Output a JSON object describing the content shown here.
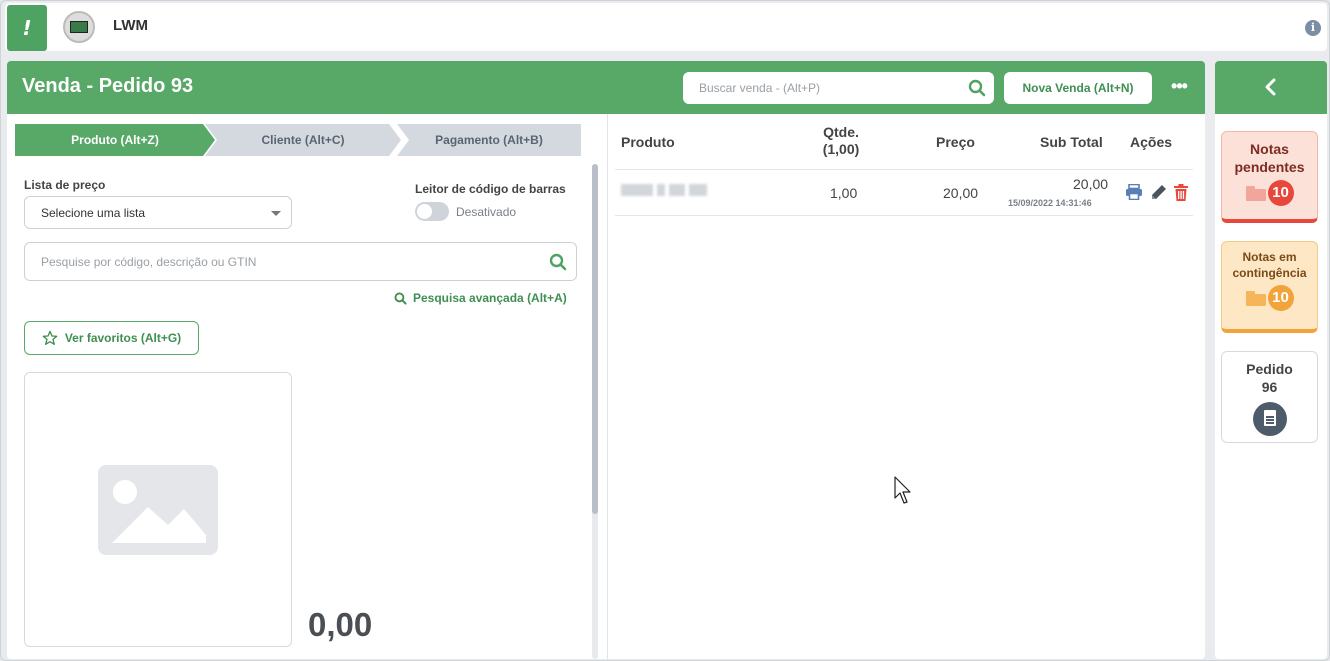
{
  "topbar": {
    "app_logo_glyph": "!",
    "entity_name": "LWM",
    "info_glyph": "i"
  },
  "header": {
    "title": "Venda - Pedido 93",
    "search_placeholder": "Buscar venda - (Alt+P)",
    "new_sale_label": "Nova Venda  (Alt+N)",
    "more_label": "•••"
  },
  "steps": [
    {
      "label": "Produto (Alt+Z)",
      "active": true
    },
    {
      "label": "Cliente (Alt+C)",
      "active": false
    },
    {
      "label": "Pagamento (Alt+B)",
      "active": false
    }
  ],
  "product_form": {
    "price_list_label": "Lista de preço",
    "price_list_value": "Selecione uma lista",
    "barcode_label": "Leitor de código de barras",
    "barcode_state": "Desativado",
    "search_placeholder": "Pesquise por código, descrição ou GTIN",
    "advanced_search": "Pesquisa avançada (Alt+A)",
    "favorites_label": "Ver favoritos (Alt+G)",
    "price_display": "0,00"
  },
  "cart": {
    "headers": {
      "product": "Produto",
      "qty": "Qtde. (1,00)",
      "price": "Preço",
      "subtotal": "Sub Total",
      "actions": "Ações"
    },
    "rows": [
      {
        "qty": "1,00",
        "price": "20,00",
        "subtotal": "20,00",
        "timestamp": "15/09/2022 14:31:46"
      }
    ]
  },
  "sidebar": {
    "cards": [
      {
        "title": "Notas pendentes",
        "count": "10",
        "color": "#e8473c"
      },
      {
        "title": "Notas em contingência",
        "count": "10",
        "color": "#f2a33a"
      },
      {
        "title": "Pedido 96"
      }
    ]
  },
  "colors": {
    "brand_green": "#58a867",
    "danger": "#e8473c",
    "warning": "#f2a33a"
  },
  "icons": [
    "search-icon",
    "star-icon",
    "image-placeholder-icon",
    "print-icon",
    "edit-icon",
    "trash-icon",
    "chevron-left-icon",
    "folder-icon",
    "document-icon",
    "info-icon"
  ]
}
